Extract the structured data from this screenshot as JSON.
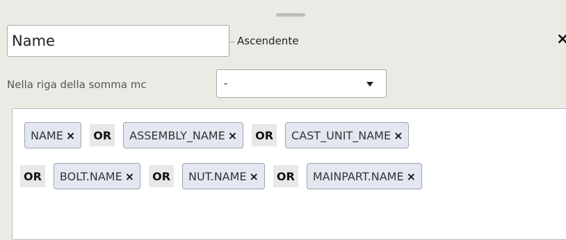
{
  "field": {
    "value": "Name"
  },
  "sort": {
    "label": "Ascendente"
  },
  "close": {
    "glyph": "×"
  },
  "sum_row": {
    "label": "Nella riga della somma mc",
    "selected": "-"
  },
  "filters": {
    "operator": "OR",
    "row1": [
      "NAME",
      "ASSEMBLY_NAME",
      "CAST_UNIT_NAME"
    ],
    "row2": [
      "BOLT.NAME",
      "NUT.NAME",
      "MAINPART.NAME"
    ],
    "remove_glyph": "×"
  }
}
